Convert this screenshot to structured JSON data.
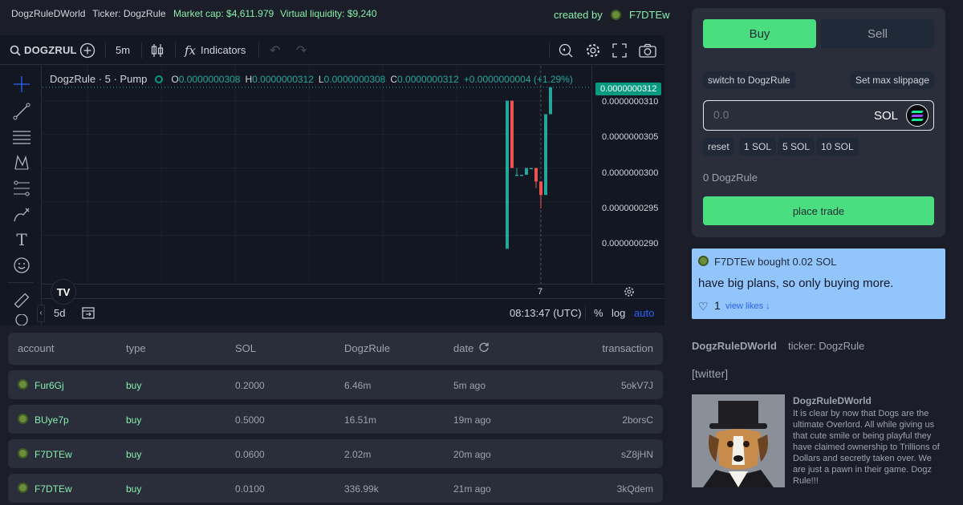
{
  "topbar": {
    "name": "DogzRuleDWorld",
    "ticker": "Ticker: DogzRule",
    "market_cap": "Market cap: $4,611.979",
    "liquidity": "Virtual liquidity: $9,240",
    "created_by": "created by",
    "creator": "F7DTEw"
  },
  "chart_toolbar": {
    "symbol": "DOGZRUL",
    "interval": "5m",
    "indicators": "Indicators"
  },
  "chart_legend": {
    "title": "DogzRule · 5 · Pump",
    "o_label": "O",
    "o": "0.0000000308",
    "h_label": "H",
    "h": "0.0000000312",
    "l_label": "L",
    "l": "0.0000000308",
    "c_label": "C",
    "c": "0.0000000312",
    "change": "+0.0000000004 (+1.29%)"
  },
  "chart_data": {
    "type": "candlestick",
    "y_ticks": [
      "0.0000000310",
      "0.0000000305",
      "0.0000000300",
      "0.0000000295",
      "0.0000000290"
    ],
    "ylim": [
      2.828e-08,
      3.152e-08
    ],
    "last_price": "0.0000000312",
    "x_ticks": [
      "7"
    ],
    "candles": [
      {
        "o": 2.88e-08,
        "h": 3.1e-08,
        "l": 2.88e-08,
        "c": 3.1e-08
      },
      {
        "o": 3.1e-08,
        "h": 3.1e-08,
        "l": 3e-08,
        "c": 3e-08
      },
      {
        "o": 2.99e-08,
        "h": 3e-08,
        "l": 2.99e-08,
        "c": 2.99e-08
      },
      {
        "o": 2.99e-08,
        "h": 2.99e-08,
        "l": 2.99e-08,
        "c": 2.99e-08
      },
      {
        "o": 2.99e-08,
        "h": 3e-08,
        "l": 2.99e-08,
        "c": 3e-08
      },
      {
        "o": 3e-08,
        "h": 3e-08,
        "l": 3e-08,
        "c": 3e-08
      },
      {
        "o": 3e-08,
        "h": 3e-08,
        "l": 2.97e-08,
        "c": 2.98e-08
      },
      {
        "o": 2.98e-08,
        "h": 2.98e-08,
        "l": 2.94e-08,
        "c": 2.96e-08
      },
      {
        "o": 2.96e-08,
        "h": 3.08e-08,
        "l": 2.96e-08,
        "c": 3.08e-08
      },
      {
        "o": 3.08e-08,
        "h": 3.12e-08,
        "l": 3.08e-08,
        "c": 3.12e-08
      }
    ]
  },
  "chart_bottom": {
    "range": "5d",
    "time": "08:13:47 (UTC)",
    "percent": "%",
    "log": "log",
    "auto": "auto"
  },
  "table": {
    "headers": [
      "account",
      "type",
      "SOL",
      "DogzRule",
      "date",
      "transaction"
    ],
    "rows": [
      {
        "account": "Fur6Gj",
        "type": "buy",
        "sol": "0.2000",
        "token": "6.46m",
        "date": "5m ago",
        "tx": "5okV7J"
      },
      {
        "account": "BUye7p",
        "type": "buy",
        "sol": "0.5000",
        "token": "16.51m",
        "date": "19m ago",
        "tx": "2borsC"
      },
      {
        "account": "F7DTEw",
        "type": "buy",
        "sol": "0.0600",
        "token": "2.02m",
        "date": "20m ago",
        "tx": "sZ8jHN"
      },
      {
        "account": "F7DTEw",
        "type": "buy",
        "sol": "0.0100",
        "token": "336.99k",
        "date": "21m ago",
        "tx": "3kQdem"
      }
    ]
  },
  "trade": {
    "buy": "Buy",
    "sell": "Sell",
    "switch": "switch to DogzRule",
    "slippage": "Set max slippage",
    "amount_placeholder": "0.0",
    "amount_unit": "SOL",
    "presets": [
      "reset",
      "1 SOL",
      "5 SOL",
      "10 SOL"
    ],
    "holdings": "0 DogzRule",
    "place": "place trade"
  },
  "comment": {
    "header": "F7DTEw bought 0.02 SOL",
    "body": "have big plans, so only buying more.",
    "likes": "1",
    "view_likes": "view likes ↓"
  },
  "info": {
    "name": "DogzRuleDWorld",
    "ticker": "ticker: DogzRule",
    "twitter": "[twitter]",
    "desc_name": "DogzRuleDWorld",
    "description": "It is clear by now that Dogs are the ultimate Overlord. All while giving us that cute smile or being playful they have claimed ownership to Trillions of Dollars and secretly taken over. We are just a pawn in their game. Dogz Rule!!!"
  },
  "colors": {
    "up": "#26a69a",
    "down": "#ef5350",
    "accent_green": "#4ade80",
    "comment_bg": "#93c5fd"
  }
}
